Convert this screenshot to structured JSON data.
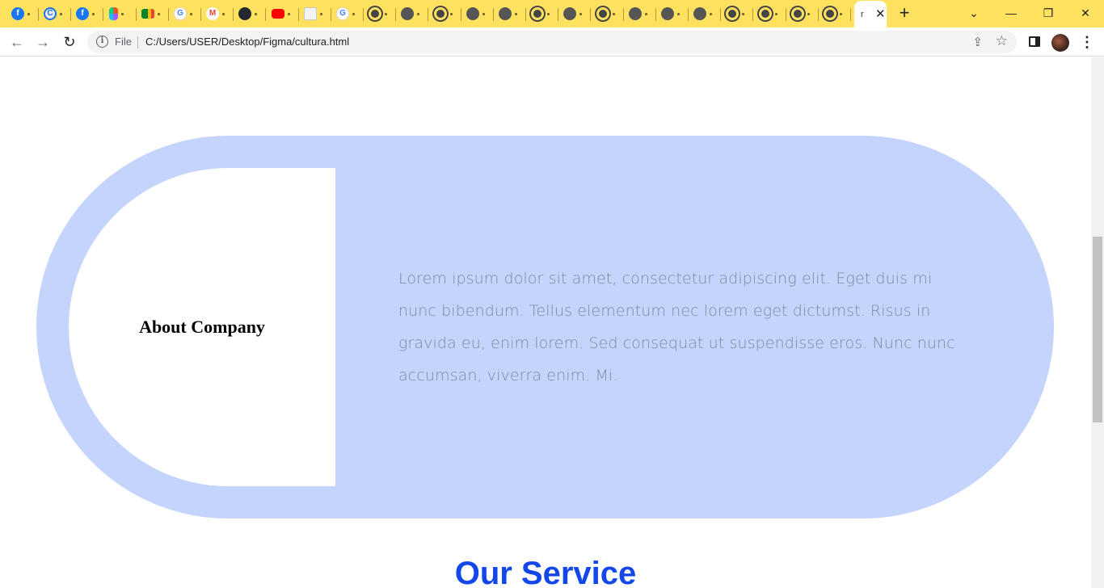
{
  "browser": {
    "tabs": [
      {
        "icon": "facebook-icon",
        "glyph": "f"
      },
      {
        "icon": "edu-icon",
        "glyph": "C"
      },
      {
        "icon": "facebook-icon",
        "glyph": "f"
      },
      {
        "icon": "figma-icon",
        "glyph": ""
      },
      {
        "icon": "google-meet-icon",
        "glyph": ""
      },
      {
        "icon": "google-icon",
        "glyph": "G"
      },
      {
        "icon": "gmail-icon",
        "glyph": "M"
      },
      {
        "icon": "github-icon",
        "glyph": ""
      },
      {
        "icon": "youtube-icon",
        "glyph": ""
      },
      {
        "icon": "document-icon",
        "glyph": ""
      },
      {
        "icon": "google-icon",
        "glyph": "G"
      },
      {
        "icon": "chrome-icon",
        "glyph": ""
      },
      {
        "icon": "globe-icon",
        "glyph": ""
      },
      {
        "icon": "chrome-icon",
        "glyph": ""
      },
      {
        "icon": "globe-icon",
        "glyph": ""
      },
      {
        "icon": "globe-icon",
        "glyph": ""
      },
      {
        "icon": "chrome-icon",
        "glyph": ""
      },
      {
        "icon": "globe-icon",
        "glyph": ""
      },
      {
        "icon": "chrome-icon",
        "glyph": ""
      },
      {
        "icon": "globe-icon",
        "glyph": ""
      },
      {
        "icon": "globe-icon",
        "glyph": ""
      },
      {
        "icon": "globe-icon",
        "glyph": ""
      },
      {
        "icon": "chrome-icon",
        "glyph": ""
      },
      {
        "icon": "chrome-icon",
        "glyph": ""
      },
      {
        "icon": "chrome-icon",
        "glyph": ""
      },
      {
        "icon": "chrome-icon",
        "glyph": ""
      }
    ],
    "active_tab": {
      "title": "r",
      "close_glyph": "✕"
    },
    "new_tab_glyph": "+",
    "window_controls": {
      "dropdown": "⌄",
      "minimize": "—",
      "restore": "❐",
      "close": "✕"
    },
    "nav": {
      "back": "←",
      "forward": "→",
      "reload": "↻"
    },
    "omnibox": {
      "info_glyph": "i",
      "scheme_label": "File",
      "url": "C:/Users/USER/Desktop/Figma/cultura.html",
      "share_glyph": "⇪",
      "star_glyph": "☆"
    },
    "menu_glyph": "⋮"
  },
  "page": {
    "about": {
      "title": "About Company",
      "body": "Lorem ipsum dolor sit amet, consectetur adipiscing elit. Eget duis mi nunc bibendum. Tellus elementum nec lorem eget dictumst. Risus in gravida eu, enim lorem. Sed consequat ut suspendisse eros. Nunc nunc accumsan, viverra enim. Mi."
    },
    "service": {
      "title": "Our Service"
    }
  },
  "colors": {
    "tabstrip": "#fde15f",
    "about_bg": "#c5d4fc",
    "about_text": "#7d8a9e",
    "service_title": "#1447ea"
  }
}
